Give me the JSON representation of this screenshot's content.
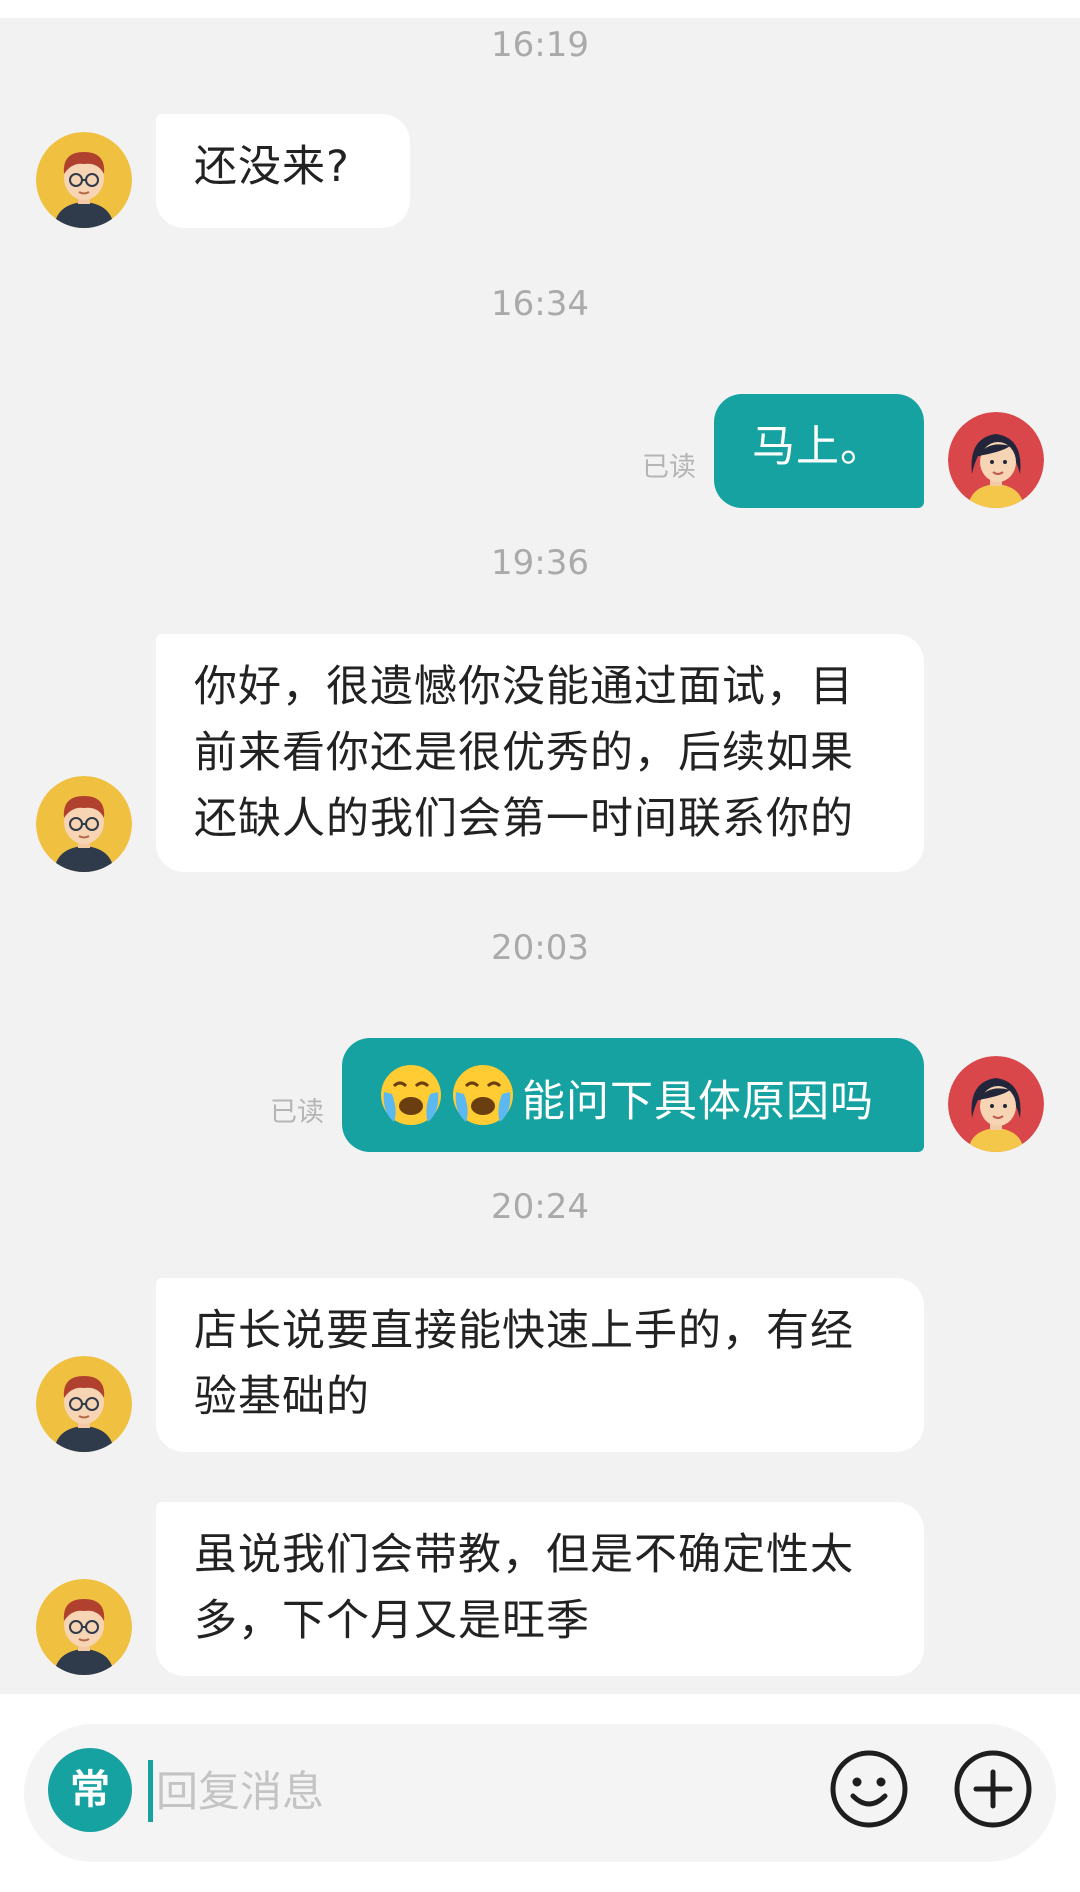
{
  "messages": {
    "t1": "16:19",
    "m1": "还没来?",
    "t2": "16:34",
    "m2": "马上。",
    "m2_read": "已读",
    "t3": "19:36",
    "m3": "你好，很遗憾你没能通过面试，目前来看你还是很优秀的，后续如果还缺人的我们会第一时间联系你的",
    "t4": "20:03",
    "m4": "能问下具体原因吗",
    "m4_emoji": [
      "loudly-crying-face",
      "loudly-crying-face"
    ],
    "m4_read": "已读",
    "t5": "20:24",
    "m5": "店长说要直接能快速上手的，有经验基础的",
    "m6": "虽说我们会带教，但是不确定性太多，下个月又是旺季"
  },
  "composer": {
    "common_label": "常",
    "placeholder": "回复消息",
    "emoji_icon": "smiley-icon",
    "plus_icon": "plus-icon"
  },
  "colors": {
    "accent": "#17a2a2",
    "background": "#f2f2f2",
    "incoming_bubble": "#ffffff",
    "timestamp": "#aaaaaa"
  }
}
